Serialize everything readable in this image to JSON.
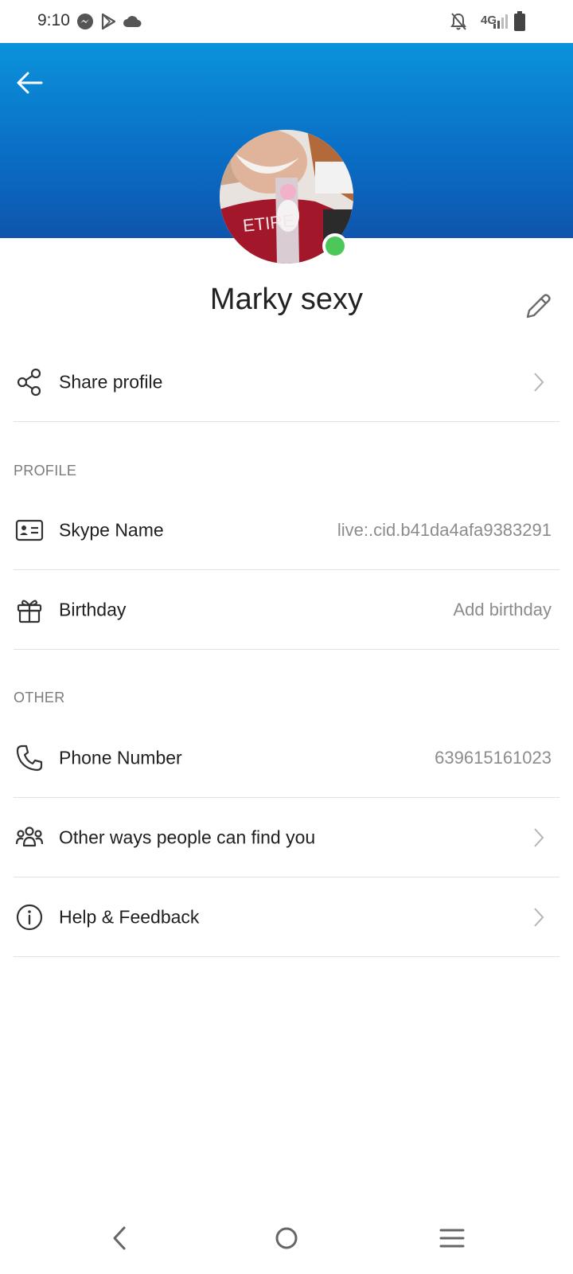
{
  "status_bar": {
    "time": "9:10",
    "left_icons": [
      "messenger-icon",
      "play-store-icon",
      "cloud-icon"
    ],
    "network": "4G",
    "right_icons": [
      "notifications-off-icon",
      "signal-icon",
      "battery-icon"
    ]
  },
  "header": {
    "back_icon": "arrow-left-icon",
    "colors": {
      "gradient_top": "#0b93da",
      "gradient_bottom": "#0f55ad"
    }
  },
  "profile": {
    "name": "Marky sexy",
    "presence": "online",
    "presence_color": "#4cc75a",
    "edit_icon": "pencil-icon"
  },
  "share": {
    "label": "Share profile",
    "icon": "share-icon"
  },
  "sections": {
    "profile_label": "PROFILE",
    "other_label": "OTHER"
  },
  "rows": {
    "skype_name": {
      "label": "Skype Name",
      "value": "live:.cid.b41da4afa9383291",
      "icon": "id-card-icon"
    },
    "birthday": {
      "label": "Birthday",
      "value": "Add birthday",
      "icon": "gift-icon"
    },
    "phone": {
      "label": "Phone Number",
      "value": "639615161023",
      "icon": "phone-icon"
    },
    "find_you": {
      "label": "Other ways people can find you",
      "icon": "people-icon"
    },
    "help": {
      "label": "Help & Feedback",
      "icon": "info-icon"
    }
  },
  "nav_bar": {
    "buttons": [
      "back-nav-icon",
      "home-nav-icon",
      "recents-nav-icon"
    ]
  }
}
